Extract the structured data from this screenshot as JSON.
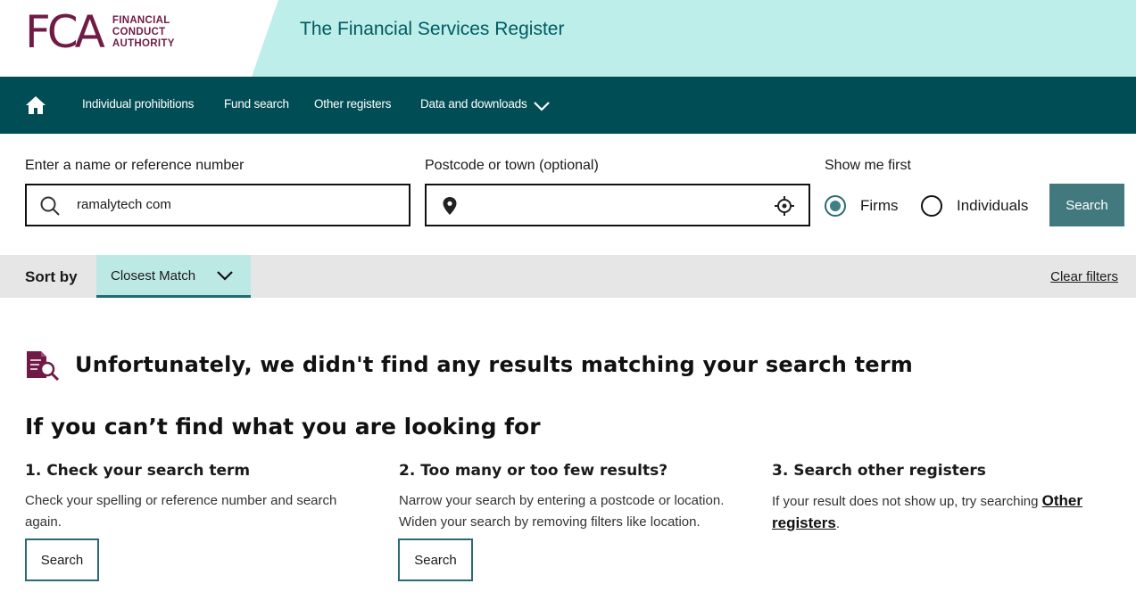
{
  "header": {
    "logo_mark": "FCA",
    "logo_lines": [
      "FINANCIAL",
      "CONDUCT",
      "AUTHORITY"
    ],
    "site_title": "The Financial Services Register"
  },
  "nav": {
    "home_icon": "home-icon",
    "items": [
      {
        "label": "Individual prohibitions"
      },
      {
        "label": "Fund search"
      },
      {
        "label": "Other registers"
      },
      {
        "label": "Data and downloads"
      }
    ]
  },
  "search": {
    "name_label": "Enter a name or reference number",
    "name_value": "ramalytech com",
    "location_label": "Postcode or town (optional)",
    "location_value": "",
    "show_first_label": "Show me first",
    "options": [
      {
        "label": "Firms",
        "selected": true
      },
      {
        "label": "Individuals",
        "selected": false
      }
    ],
    "button_label": "Search"
  },
  "sort": {
    "label": "Sort by",
    "value": "Closest Match",
    "clear_filters": "Clear filters"
  },
  "results": {
    "no_results_message": "Unfortunately, we didn't find any results matching your search term",
    "help_heading": "If you can’t find what you are looking for",
    "columns": [
      {
        "title": "1. Check your search term",
        "lines": [
          "Check your spelling or reference number and search",
          "again."
        ],
        "button": "Search"
      },
      {
        "title": "2. Too many or too few results?",
        "lines": [
          "Narrow your search by entering a postcode or location.",
          "Widen your search by removing filters like location."
        ],
        "button": "Search"
      },
      {
        "title": "3. Search other registers",
        "text_before": "If your result does not show up, try searching ",
        "link_part1": "Other",
        "link_part2": "registers",
        "text_after": "."
      }
    ]
  },
  "colors": {
    "brand": "#701b45",
    "nav_bg": "#014d55",
    "header_accent": "#bdeeea",
    "button": "#42797f"
  }
}
